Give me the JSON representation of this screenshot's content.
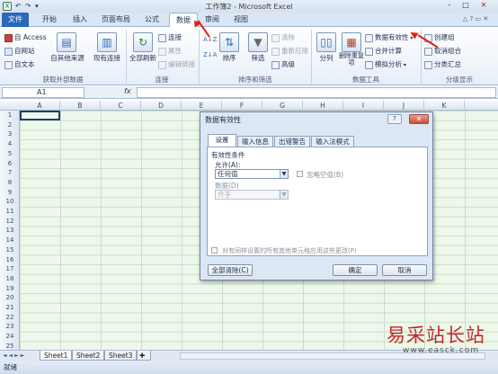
{
  "app": {
    "title": "工作簿2 - Microsoft Excel",
    "quick_access": [
      "X",
      "↶",
      "↷",
      "▾"
    ],
    "window_buttons": [
      "?",
      "-",
      "□",
      "✕"
    ]
  },
  "tabs": {
    "file": "文件",
    "items": [
      "开始",
      "插入",
      "页面布局",
      "公式",
      "数据",
      "审阅",
      "视图"
    ],
    "active": "数据"
  },
  "ribbon": {
    "get_external": {
      "access": "自 Access",
      "web": "自网站",
      "text": "自文本",
      "other_sources": "自其他来源",
      "existing": "现有连接",
      "label": "获取外部数据"
    },
    "connections": {
      "refresh_all": "全部刷新",
      "connections": "连接",
      "properties": "属性",
      "edit_links": "编辑链接",
      "label": "连接"
    },
    "sort_filter": {
      "sort": "排序",
      "filter": "筛选",
      "clear": "清除",
      "reapply": "重新应用",
      "advanced": "高级",
      "label": "排序和筛选"
    },
    "data_tools": {
      "text_to_columns": "分列",
      "remove_duplicates": "删除重复项",
      "data_validation": "数据有效性",
      "consolidate": "合并计算",
      "what_if": "模拟分析",
      "label": "数据工具"
    },
    "outline": {
      "group": "创建组",
      "ungroup": "取消组合",
      "subtotal": "分类汇总",
      "label": "分级显示"
    }
  },
  "formula_bar": {
    "name_box": "A1",
    "fx": "fx",
    "content": ""
  },
  "grid": {
    "columns": [
      "A",
      "B",
      "C",
      "D",
      "E",
      "F",
      "G",
      "H",
      "I",
      "J",
      "K"
    ],
    "rows": [
      "1",
      "2",
      "3",
      "4",
      "5",
      "6",
      "7",
      "8",
      "9",
      "10",
      "11",
      "12",
      "13",
      "14",
      "15",
      "16",
      "17",
      "18",
      "19",
      "20",
      "21",
      "22",
      "23",
      "24",
      "25"
    ]
  },
  "sheets": {
    "tabs": [
      "Sheet1",
      "Sheet2",
      "Sheet3"
    ],
    "active": "Sheet1",
    "nav": [
      "◄",
      "◄",
      "►",
      "►"
    ]
  },
  "status": {
    "ready": "就绪"
  },
  "dialog": {
    "title": "数据有效性",
    "tabs": [
      "设置",
      "输入信息",
      "出错警告",
      "输入法模式"
    ],
    "active_tab": "设置",
    "criteria_label": "有效性条件",
    "allow_label": "允许(A):",
    "allow_value": "任何值",
    "ignore_blank": "忽略空值(B)",
    "data_label": "数据(D)",
    "data_value": "介于",
    "apply_all": "对有同样设置的所有其他单元格应用这些更改(P)",
    "clear_all": "全部清除(C)",
    "ok": "确定",
    "cancel": "取消"
  },
  "watermark": {
    "brand": "易采站长站",
    "url": "www.easck.com"
  }
}
